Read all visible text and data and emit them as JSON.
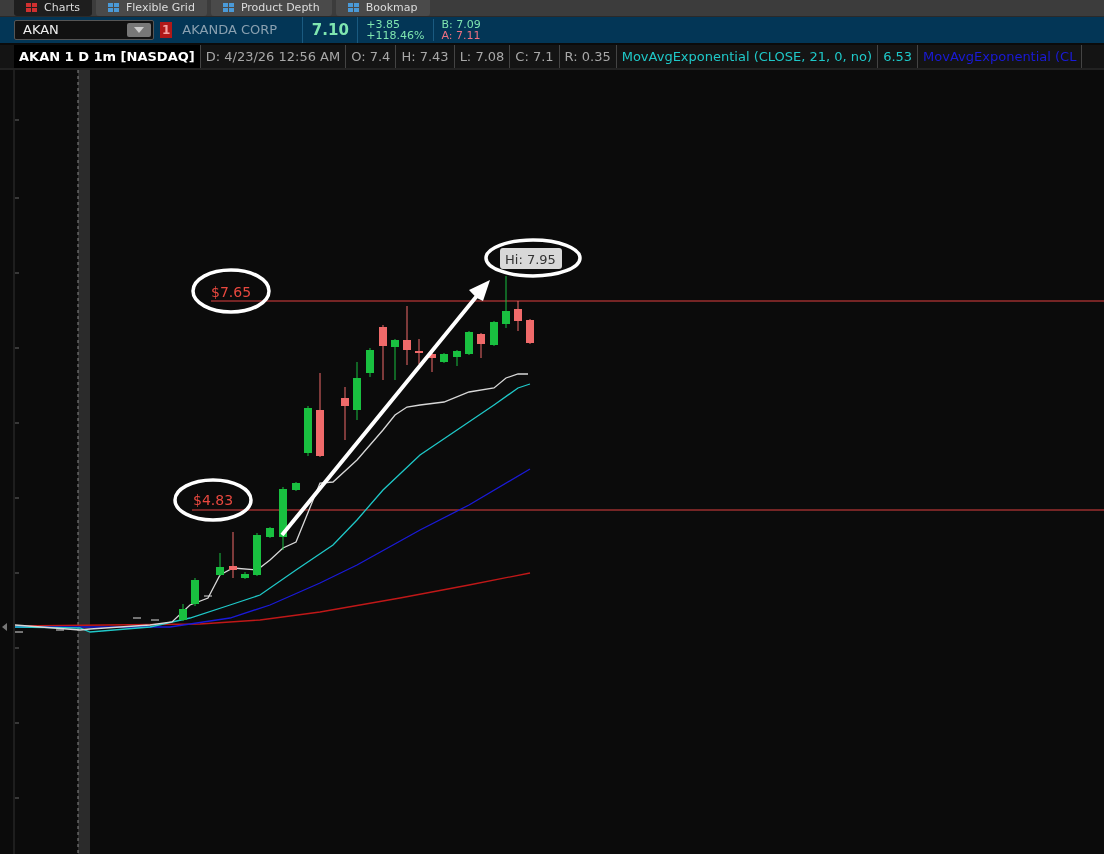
{
  "tabs": [
    {
      "label": "Charts",
      "selected": true
    },
    {
      "label": "Flexible Grid",
      "selected": false
    },
    {
      "label": "Product Depth",
      "selected": false
    },
    {
      "label": "Bookmap",
      "selected": false
    }
  ],
  "quote_bar": {
    "symbol": "AKAN",
    "link_badge": "1",
    "company": "AKANDA CORP",
    "last": "7.10",
    "change": "+3.85",
    "change_pct": "+118.46%",
    "bid": "B: 7.09",
    "ask": "A: 7.11"
  },
  "chart_header": {
    "title": "AKAN 1 D 1m [NASDAQ]",
    "cells": [
      "D: 4/23/26 12:56 AM",
      "O: 7.4",
      "H: 7.43",
      "L: 7.08",
      "C: 7.1",
      "R: 0.35"
    ],
    "studies": [
      {
        "name": "MovAvgExponential (CLOSE, 21, 0, no)",
        "value": "6.53",
        "color": "#1fc8c8"
      },
      {
        "name": "MovAvgExponential (CL",
        "color": "#1a1ad8"
      }
    ]
  },
  "annotations": [
    {
      "kind": "circled-price",
      "text": "$7.65"
    },
    {
      "kind": "circled-price",
      "text": "$4.83"
    },
    {
      "kind": "high-label",
      "text": "Hi: 7.95"
    }
  ]
}
